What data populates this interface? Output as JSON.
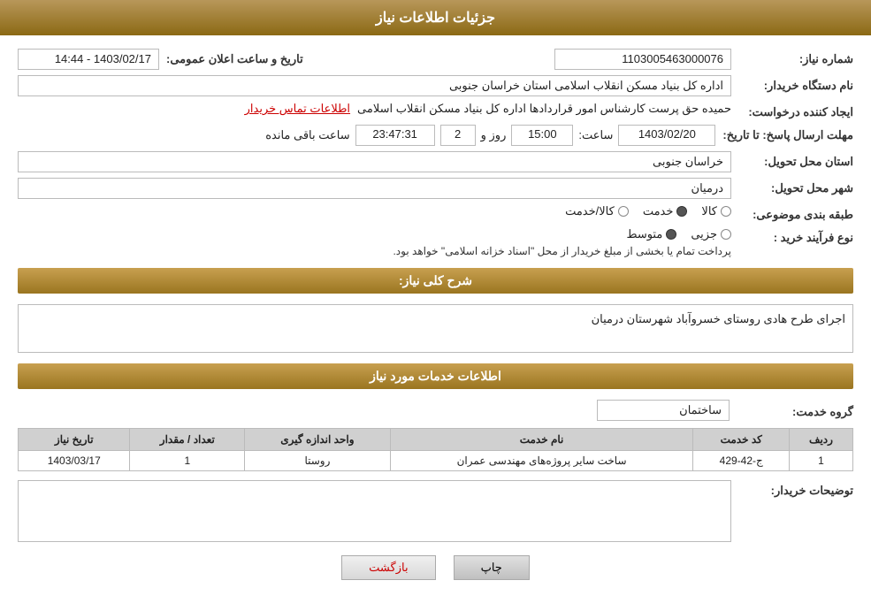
{
  "header": {
    "title": "جزئیات اطلاعات نیاز"
  },
  "sections": {
    "details_title": "جزئیات اطلاعات نیاز",
    "services_title": "اطلاعات خدمات مورد نیاز"
  },
  "fields": {
    "need_number_label": "شماره نیاز:",
    "need_number_value": "1103005463000076",
    "buyer_org_label": "نام دستگاه خریدار:",
    "buyer_org_value": "اداره کل بنیاد مسکن انقلاب اسلامی استان خراسان جنوبی",
    "creator_label": "ایجاد کننده درخواست:",
    "creator_value": "حمیده حق پرست کارشناس امور قراردادها اداره کل بنیاد مسکن انقلاب اسلامی",
    "creator_link": "اطلاعات تماس خریدار",
    "date_label": "تاریخ و ساعت اعلان عمومی:",
    "date_value": "1403/02/17 - 14:44",
    "deadline_label": "مهلت ارسال پاسخ: تا تاریخ:",
    "deadline_date": "1403/02/20",
    "deadline_time_label": "ساعت:",
    "deadline_time": "15:00",
    "remaining_label": "روز و",
    "remaining_days": "2",
    "remaining_time": "23:47:31",
    "remaining_suffix": "ساعت باقی مانده",
    "province_label": "استان محل تحویل:",
    "province_value": "خراسان جنوبی",
    "city_label": "شهر محل تحویل:",
    "city_value": "درمیان",
    "category_label": "طبقه بندی موضوعی:",
    "category_options": [
      {
        "label": "کالا",
        "selected": false
      },
      {
        "label": "خدمت",
        "selected": true
      },
      {
        "label": "کالا/خدمت",
        "selected": false
      }
    ],
    "purchase_type_label": "نوع فرآیند خرید :",
    "purchase_type_options": [
      {
        "label": "جزیی",
        "selected": false
      },
      {
        "label": "متوسط",
        "selected": true
      }
    ],
    "purchase_note": "پرداخت تمام یا بخشی از مبلغ خریدار از محل \"اسناد خزانه اسلامی\" خواهد بود.",
    "description_label": "شرح کلی نیاز:",
    "description_value": "اجرای طرح هادی روستای خسروآباد شهرستان درمیان",
    "service_group_label": "گروه خدمت:",
    "service_group_value": "ساختمان",
    "buyer_notes_label": "توضیحات خریدار:"
  },
  "service_table": {
    "columns": [
      "ردیف",
      "کد خدمت",
      "نام خدمت",
      "واحد اندازه گیری",
      "تعداد / مقدار",
      "تاریخ نیاز"
    ],
    "rows": [
      {
        "row": "1",
        "code": "ج-42-429",
        "name": "ساخت سایر پروژه‌های مهندسی عمران",
        "unit": "روستا",
        "quantity": "1",
        "date": "1403/03/17"
      }
    ]
  },
  "buttons": {
    "print": "چاپ",
    "back": "بازگشت"
  }
}
